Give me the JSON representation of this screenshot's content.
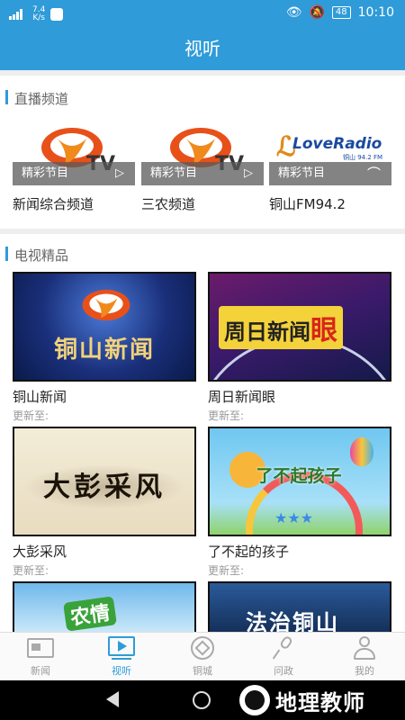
{
  "status": {
    "net": "4G",
    "speed_value": "7.4",
    "speed_unit": "K/s",
    "battery": "48",
    "time": "10:10"
  },
  "header": {
    "title": "视听"
  },
  "live": {
    "section_title": "直播频道",
    "channels": [
      {
        "overlay": "精彩节目",
        "name": "新闻综合频道",
        "logo_text": "TV"
      },
      {
        "overlay": "精彩节目",
        "name": "三农频道",
        "logo_text": "TV"
      },
      {
        "overlay": "精彩节目",
        "name": "铜山FM94.2",
        "logo_text": "LoveRadio",
        "logo_sub": "铜山 94.2 FM"
      }
    ]
  },
  "programs": {
    "section_title": "电视精品",
    "items": [
      {
        "name": "铜山新闻",
        "update": "更新至:",
        "thumb_text": "铜山新闻"
      },
      {
        "name": "周日新闻眼",
        "update": "更新至:",
        "thumb_text": "周日新闻",
        "thumb_accent": "眼"
      },
      {
        "name": "大彭采风",
        "update": "更新至:",
        "thumb_text": "大彭采风"
      },
      {
        "name": "了不起的孩子",
        "update": "更新至:",
        "thumb_text": "了不起孩子"
      },
      {
        "thumb_text": "农情"
      },
      {
        "thumb_text": "法治铜山"
      }
    ]
  },
  "tabbar": {
    "tabs": [
      {
        "label": "新闻"
      },
      {
        "label": "视听"
      },
      {
        "label": "铜城"
      },
      {
        "label": "问政"
      },
      {
        "label": "我的"
      }
    ]
  },
  "watermark": {
    "text": "地理教师"
  },
  "colors": {
    "primary": "#2f9bd8",
    "tab_inactive": "#999999"
  }
}
